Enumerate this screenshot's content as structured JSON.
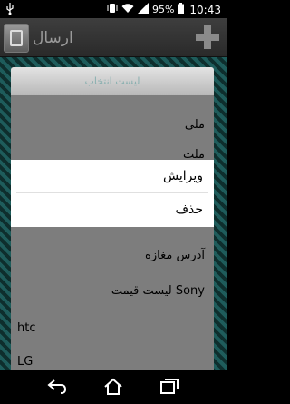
{
  "status_bar": {
    "battery_percent": "95%",
    "time": "10:43"
  },
  "action_bar": {
    "send_label": "ارسال"
  },
  "dialog": {
    "title": "لیست انتخاب",
    "items": [
      {
        "label": "ملی"
      },
      {
        "label": "ملت"
      },
      {
        "label": ""
      },
      {
        "label": ""
      },
      {
        "label": "آدرس مغازه"
      },
      {
        "label": "لیست قیمت Sony"
      },
      {
        "label": "htc"
      },
      {
        "label": "LG"
      }
    ]
  },
  "context_menu": {
    "edit_label": "ویرایش",
    "delete_label": "حذف"
  },
  "colors": {
    "stripe_teal": "#1e5c5b",
    "dialog_bg": "#7d7d7d"
  }
}
